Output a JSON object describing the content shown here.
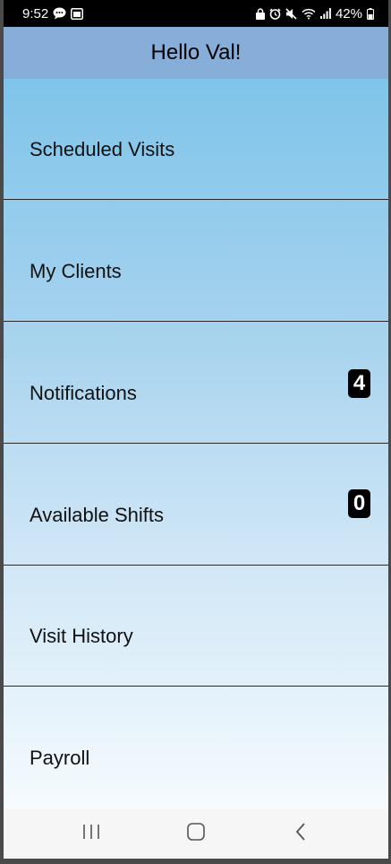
{
  "status_bar": {
    "time": "9:52",
    "battery": "42%",
    "left_icons": [
      "chat-icon",
      "calendar-icon"
    ],
    "right_icons": [
      "lock-icon",
      "alarm-icon",
      "mute-icon",
      "wifi-icon",
      "signal-icon",
      "battery-icon"
    ]
  },
  "header": {
    "title": "Hello Val!"
  },
  "menu": {
    "items": [
      {
        "label": "Scheduled Visits"
      },
      {
        "label": "My Clients"
      },
      {
        "label": "Notifications",
        "badge": "4"
      },
      {
        "label": "Available Shifts",
        "badge": "0"
      },
      {
        "label": "Visit History"
      },
      {
        "label": "Payroll"
      }
    ]
  },
  "nav_bar": {
    "icons": [
      "recent-apps-icon",
      "home-icon",
      "back-icon"
    ]
  },
  "colors": {
    "header_bg": "#86aed8",
    "menu_top": "#7fc4ea",
    "menu_bottom": "#f5fbfe",
    "badge_bg": "#000000"
  }
}
